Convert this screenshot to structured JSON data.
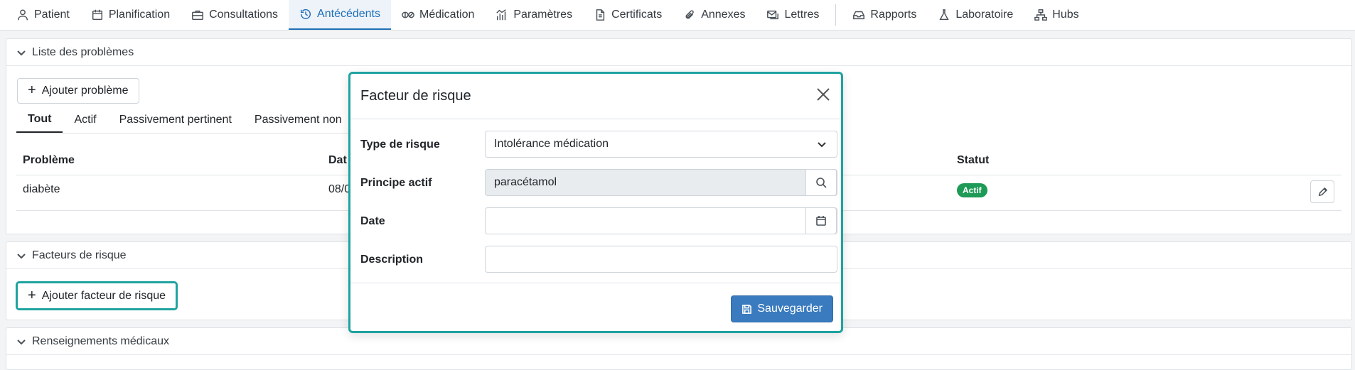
{
  "nav": {
    "tabs": [
      {
        "label": "Patient",
        "icon": "user-icon"
      },
      {
        "label": "Planification",
        "icon": "calendar-icon"
      },
      {
        "label": "Consultations",
        "icon": "briefcase-icon"
      },
      {
        "label": "Antécédents",
        "icon": "history-icon"
      },
      {
        "label": "Médication",
        "icon": "pills-icon"
      },
      {
        "label": "Paramètres",
        "icon": "chart-icon"
      },
      {
        "label": "Certificats",
        "icon": "document-icon"
      },
      {
        "label": "Annexes",
        "icon": "paperclip-icon"
      },
      {
        "label": "Lettres",
        "icon": "envelope-icon"
      },
      {
        "label": "Rapports",
        "icon": "inbox-icon"
      },
      {
        "label": "Laboratoire",
        "icon": "flask-icon"
      },
      {
        "label": "Hubs",
        "icon": "network-icon"
      }
    ],
    "active": "Antécédents"
  },
  "problems_panel": {
    "title": "Liste des problèmes",
    "add_button": "Ajouter problème",
    "tabs": [
      "Tout",
      "Actif",
      "Passivement pertinent",
      "Passivement non"
    ],
    "columns": {
      "problem": "Problème",
      "date": "Dat",
      "status": "Statut"
    },
    "rows": [
      {
        "problem": "diabète",
        "date": "08/0",
        "status": "Actif"
      }
    ]
  },
  "risk_panel": {
    "title": "Facteurs de risque",
    "add_button": "Ajouter facteur de risque"
  },
  "medical_panel": {
    "title": "Renseignements médicaux"
  },
  "modal": {
    "title": "Facteur de risque",
    "fields": {
      "risk_type": {
        "label": "Type de risque",
        "value": "Intolérance médication"
      },
      "active_ingredient": {
        "label": "Principe actif",
        "value": "paracétamol"
      },
      "date": {
        "label": "Date",
        "value": ""
      },
      "description": {
        "label": "Description",
        "value": ""
      }
    },
    "save_button": "Sauvegarder"
  },
  "colors": {
    "accent": "#1d6fb8",
    "highlight": "#1fa3a0",
    "active_badge": "#1d9a55",
    "primary_button": "#3a7bbf"
  }
}
